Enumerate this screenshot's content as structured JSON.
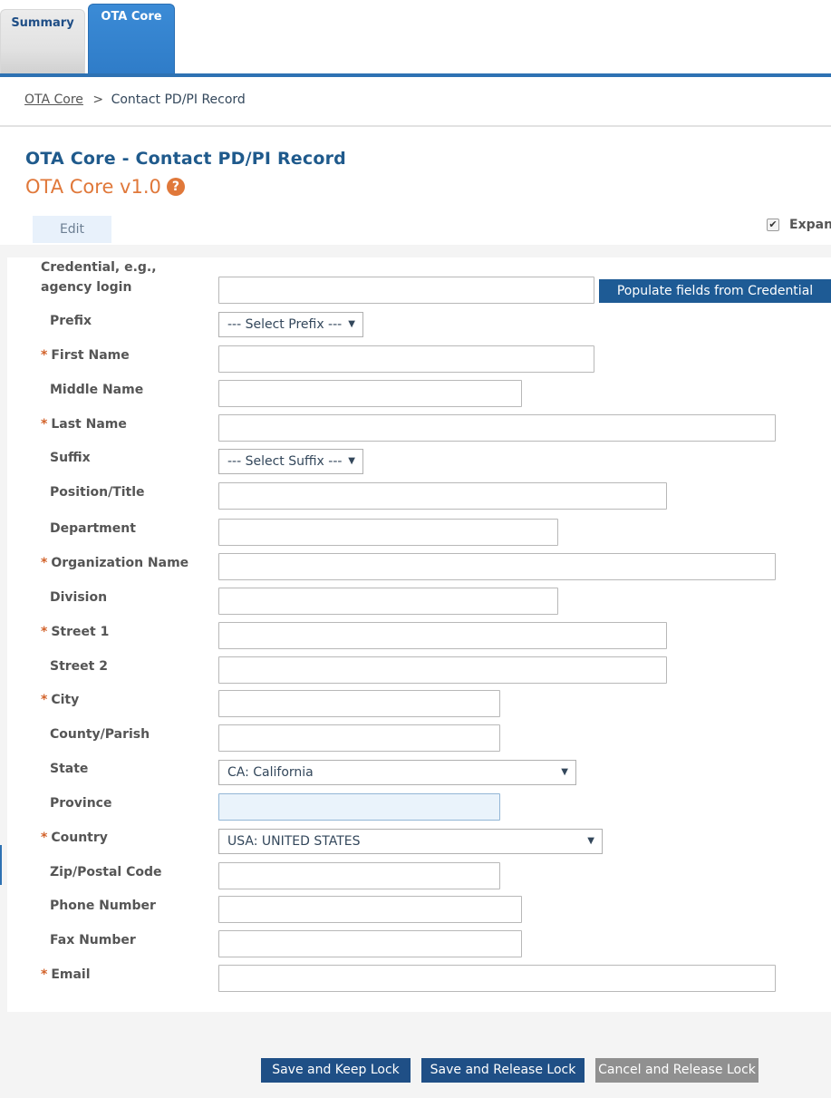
{
  "tabs": {
    "summary": "Summary",
    "core": "OTA Core"
  },
  "breadcrumb": {
    "link": "OTA Core",
    "separator": ">",
    "current": "Contact PD/PI Record"
  },
  "header": {
    "title": "OTA Core - Contact PD/PI Record",
    "version": "OTA Core v1.0",
    "help_icon": "?"
  },
  "toolbar": {
    "edit_label": "Edit",
    "expand_label": "Expand",
    "expand_checked": true
  },
  "form": {
    "required_marker": "*",
    "credential_label": "Credential, e.g., agency login",
    "populate_button": "Populate fields from Credential",
    "prefix_label": "Prefix",
    "prefix_value": "--- Select Prefix ---",
    "first_name_label": "First Name",
    "middle_name_label": "Middle Name",
    "last_name_label": "Last Name",
    "suffix_label": "Suffix",
    "suffix_value": "--- Select Suffix ---",
    "position_label": "Position/Title",
    "department_label": "Department",
    "organization_label": "Organization Name",
    "division_label": "Division",
    "street1_label": "Street 1",
    "street2_label": "Street 2",
    "city_label": "City",
    "county_label": "County/Parish",
    "state_label": "State",
    "state_value": "CA: California",
    "province_label": "Province",
    "country_label": "Country",
    "country_value": "USA: UNITED STATES",
    "zip_label": "Zip/Postal Code",
    "phone_label": "Phone Number",
    "fax_label": "Fax Number",
    "email_label": "Email"
  },
  "actions": {
    "save_keep": "Save and Keep Lock",
    "save_release": "Save and Release Lock",
    "cancel_release": "Cancel and Release Lock"
  }
}
